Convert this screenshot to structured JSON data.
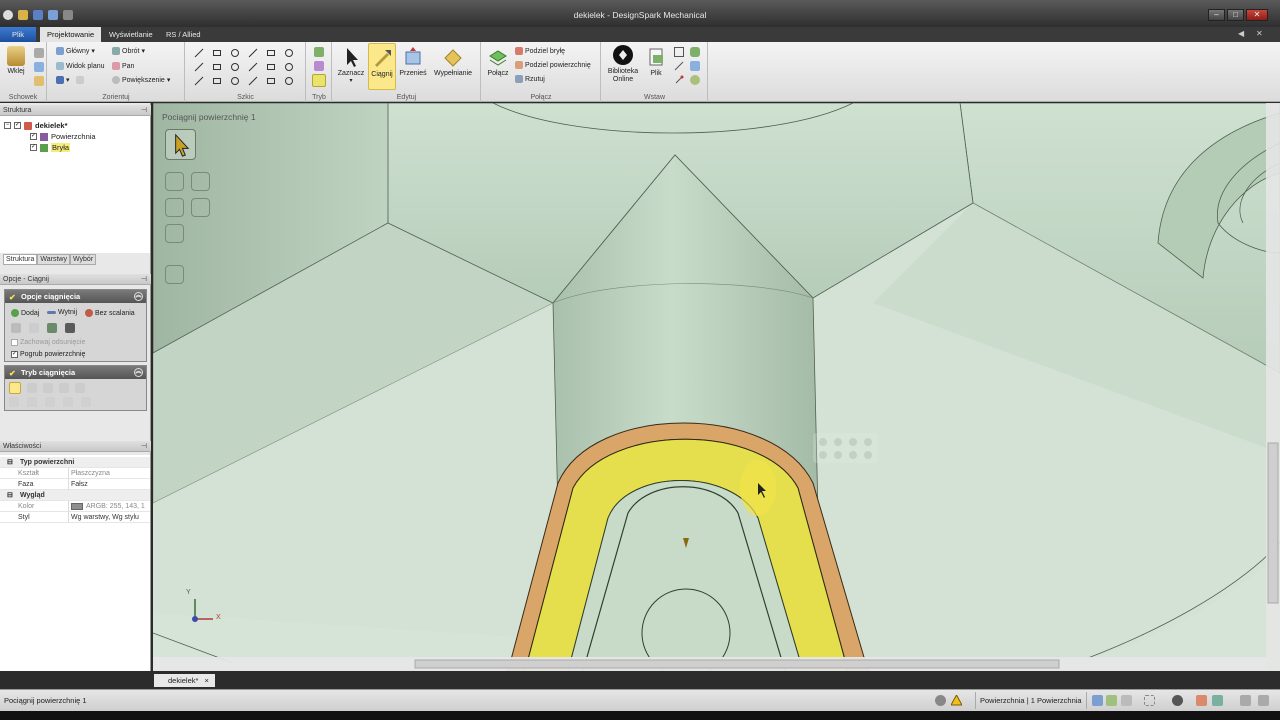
{
  "window": {
    "title": "dekielek - DesignSpark Mechanical",
    "controls": [
      "–",
      "□",
      "✕"
    ]
  },
  "menu_tabs": [
    {
      "label": "Plik",
      "active": false
    },
    {
      "label": "Projektowanie",
      "active": true
    },
    {
      "label": "Wyświetlanie",
      "active": false
    },
    {
      "label": "RS / Allied",
      "active": false
    }
  ],
  "ribbon": {
    "schowek": {
      "label": "Schowek",
      "paste": "Wklej"
    },
    "zorientuj": {
      "label": "Zorientuj",
      "home": "Główny",
      "rotate": "Obrót",
      "plan_view": "Widok planu",
      "pan": "Pan",
      "zoom": "Powiększenie"
    },
    "szkic": {
      "label": "Szkic"
    },
    "tryb": {
      "label": "Tryb"
    },
    "edytuj": {
      "label": "Edytuj",
      "select": "Zaznacz",
      "pull": "Ciągnij",
      "move": "Przenieś",
      "fill": "Wypełnianie"
    },
    "polacz": {
      "label": "Połącz",
      "combine": "Połącz",
      "split_body": "Podziel bryłę",
      "split_surface": "Podziel powierzchnię",
      "project": "Rzutuj"
    },
    "wstaw": {
      "label": "Wstaw",
      "library": "Biblioteka Online",
      "file": "Plik"
    }
  },
  "structure": {
    "header": "Struktura",
    "root": "dekielek*",
    "items": [
      "Powierzchnia",
      "Bryła"
    ],
    "subtabs": [
      "Struktura",
      "Warstwy",
      "Wybór"
    ]
  },
  "options": {
    "header": "Opcje - Ciągnij",
    "pull_options": {
      "title": "Opcje ciągnięcia",
      "add": "Dodaj",
      "cut": "Wytnij",
      "no_merge": "Bez scalania",
      "keep_offset": "Zachowaj odsunięcie",
      "thicken": "Pogrub powierzchnię"
    },
    "pull_mode": {
      "title": "Tryb ciągnięcia"
    }
  },
  "properties": {
    "header": "Właściwości",
    "sections": [
      {
        "title": "Typ powierzchni",
        "rows": [
          [
            "Kształt",
            "Płaszczyzna"
          ],
          [
            "Faza",
            "Fałsz"
          ]
        ]
      },
      {
        "title": "Wygląd",
        "rows": [
          [
            "Kolor",
            "ARGB: 255, 143, 1"
          ],
          [
            "Styl",
            "Wg warstwy, Wg stylu"
          ]
        ]
      }
    ]
  },
  "viewport": {
    "label": "Pociągnij powierzchnię 1",
    "axis_x": "X",
    "axis_y": "Y"
  },
  "doc_tab": "dekielek*",
  "status": {
    "text": "Pociągnij powierzchnię 1",
    "selection": "Powierzchnia | 1 Powierzchnia"
  },
  "colors": {
    "model_green": "#c3d9c5",
    "highlight_yellow": "#e8e04a",
    "face_orange": "#d9a568",
    "background": "#d2e0d4"
  }
}
